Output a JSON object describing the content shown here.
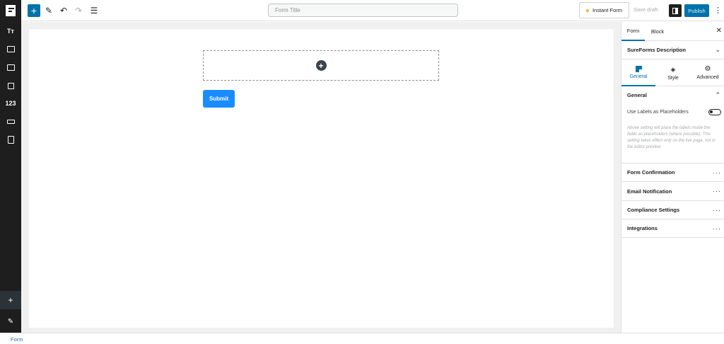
{
  "toolbar": {
    "title_placeholder": "Form Title",
    "instant_form": "Instant Form",
    "save_draft": "Save draft",
    "publish": "Publish",
    "add_symbol": "+",
    "pen_symbol": "✎",
    "undo_symbol": "↶",
    "redo_symbol": "↷",
    "list_symbol": "☰",
    "more_symbol": "⋮"
  },
  "sidebar": {
    "text_symbol": "Tт",
    "number_label": "123",
    "add_symbol": "+",
    "pen_symbol": "✎"
  },
  "canvas": {
    "add_block_symbol": "+",
    "submit_label": "Submit"
  },
  "panel": {
    "tabs": {
      "form": "Form",
      "block": "Block"
    },
    "close_symbol": "✕",
    "description": "SureForms Description",
    "chevron_down": "⌄",
    "chevron_up": "⌃",
    "subtabs": {
      "general": "General",
      "style": "Style",
      "advanced": "Advanced"
    },
    "style_symbol": "◈",
    "advanced_symbol": "⚙",
    "section_general": "General",
    "toggle_label": "Use Labels as Placeholders",
    "help_text": "Above setting will place the labels inside the fields as placeholders (where possible). This setting takes effect only on the live page, not in the editor preview.",
    "rows": [
      {
        "label": "Form Confirmation",
        "more": "···"
      },
      {
        "label": "Email Notification",
        "more": "···"
      },
      {
        "label": "Compliance Settings",
        "more": "···"
      },
      {
        "label": "Integrations",
        "more": "···"
      }
    ]
  },
  "footer": {
    "breadcrumb": "Form"
  },
  "colors": {
    "accent": "#0073aa",
    "submit": "#1a8cff",
    "dark": "#1e1e1e"
  }
}
